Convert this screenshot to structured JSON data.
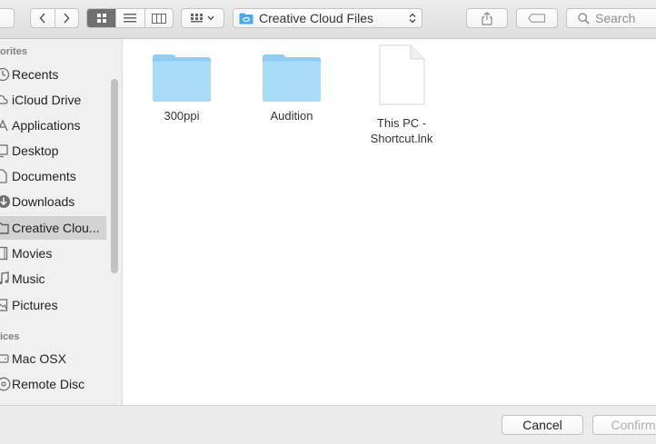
{
  "toolbar": {
    "back_icon": "chevron-left-icon",
    "forward_icon": "chevron-right-icon",
    "view_modes": [
      "icon-view-icon",
      "list-view-icon",
      "column-view-icon"
    ],
    "active_view": "icon-view-icon",
    "arrange_icon": "arrange-grid-icon",
    "path_label": "Creative Cloud Files",
    "share_icon": "share-icon",
    "tag_icon": "tag-icon",
    "search_placeholder": "Search"
  },
  "sidebar": {
    "favorites_header": "orites",
    "favorites": [
      {
        "label": "Recents",
        "icon": "clock-icon"
      },
      {
        "label": "iCloud Drive",
        "icon": "cloud-icon"
      },
      {
        "label": "Applications",
        "icon": "applications-icon"
      },
      {
        "label": "Desktop",
        "icon": "desktop-icon"
      },
      {
        "label": "Documents",
        "icon": "documents-icon"
      },
      {
        "label": "Downloads",
        "icon": "downloads-icon"
      },
      {
        "label": "Creative Clou...",
        "icon": "folder-icon",
        "selected": true
      },
      {
        "label": "Movies",
        "icon": "movies-icon"
      },
      {
        "label": "Music",
        "icon": "music-icon"
      },
      {
        "label": "Pictures",
        "icon": "pictures-icon"
      }
    ],
    "devices_header": "ices",
    "devices": [
      {
        "label": "Mac OSX",
        "icon": "drive-icon"
      },
      {
        "label": "Remote Disc",
        "icon": "disc-icon"
      }
    ]
  },
  "files": [
    {
      "name": "300ppi",
      "type": "folder"
    },
    {
      "name": "Audition",
      "type": "folder"
    },
    {
      "name": "This PC -\nShortcut.lnk",
      "type": "document"
    }
  ],
  "footer": {
    "cancel_label": "Cancel",
    "confirm_label": "Confirm"
  },
  "colors": {
    "folder_blue": "#a9dcf7",
    "selected_row": "#d2d2d2",
    "sidebar_bg": "#f0f0f0"
  }
}
